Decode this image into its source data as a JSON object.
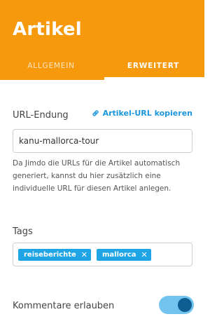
{
  "header": {
    "title": "Artikel",
    "tabs": [
      {
        "label": "ALLGEMEIN",
        "active": false
      },
      {
        "label": "ERWEITERT",
        "active": true
      }
    ]
  },
  "url_section": {
    "label": "URL-Endung",
    "copy_link": "Artikel-URL kopieren",
    "value": "kanu-mallorca-tour",
    "help": "Da Jimdo die URLs für die Artikel automatisch generiert, kannst du hier zusätzlich eine individuelle URL für diesen Artikel anlegen."
  },
  "tags_section": {
    "label": "Tags",
    "tags": [
      "reiseberichte",
      "mallorca"
    ],
    "remove_symbol": "✕"
  },
  "comments": {
    "label": "Kommentare erlauben",
    "enabled": true
  },
  "colors": {
    "accent": "#f7990c",
    "link": "#1c97dd",
    "tag": "#1fa4e6",
    "toggle_track": "#72c4ef",
    "toggle_knob": "#0f5d91"
  }
}
